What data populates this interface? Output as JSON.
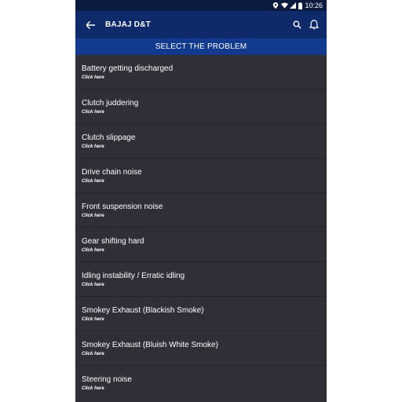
{
  "status_bar": {
    "time": "10:26"
  },
  "app_bar": {
    "title": "BAJAJ D&T"
  },
  "subheader": {
    "text": "SELECT THE PROBLEM"
  },
  "list": {
    "items": [
      {
        "title": "Battery getting discharged",
        "subtitle": "Click here"
      },
      {
        "title": "Clutch juddering",
        "subtitle": "Click here"
      },
      {
        "title": "Clutch slippage",
        "subtitle": "Click here"
      },
      {
        "title": "Drive chain noise",
        "subtitle": "Click here"
      },
      {
        "title": "Front suspension noise",
        "subtitle": "Click here"
      },
      {
        "title": "Gear shifting hard",
        "subtitle": "Click here"
      },
      {
        "title": "Idling instability / Erratic idling",
        "subtitle": "Click here"
      },
      {
        "title": "Smokey Exhaust (Blackish Smoke)",
        "subtitle": "Click here"
      },
      {
        "title": "Smokey Exhaust (Bluish White Smoke)",
        "subtitle": "Click here"
      },
      {
        "title": "Steering noise",
        "subtitle": "Click here"
      }
    ]
  },
  "colors": {
    "status_bar": "#0b1a3f",
    "app_bar": "#0f2a6b",
    "subheader": "#123a8f",
    "list_bg": "#2f2f38"
  },
  "icons": [
    "back-arrow-icon",
    "search-icon",
    "bell-icon",
    "location-icon",
    "wifi-icon",
    "signal-icon",
    "battery-icon"
  ]
}
